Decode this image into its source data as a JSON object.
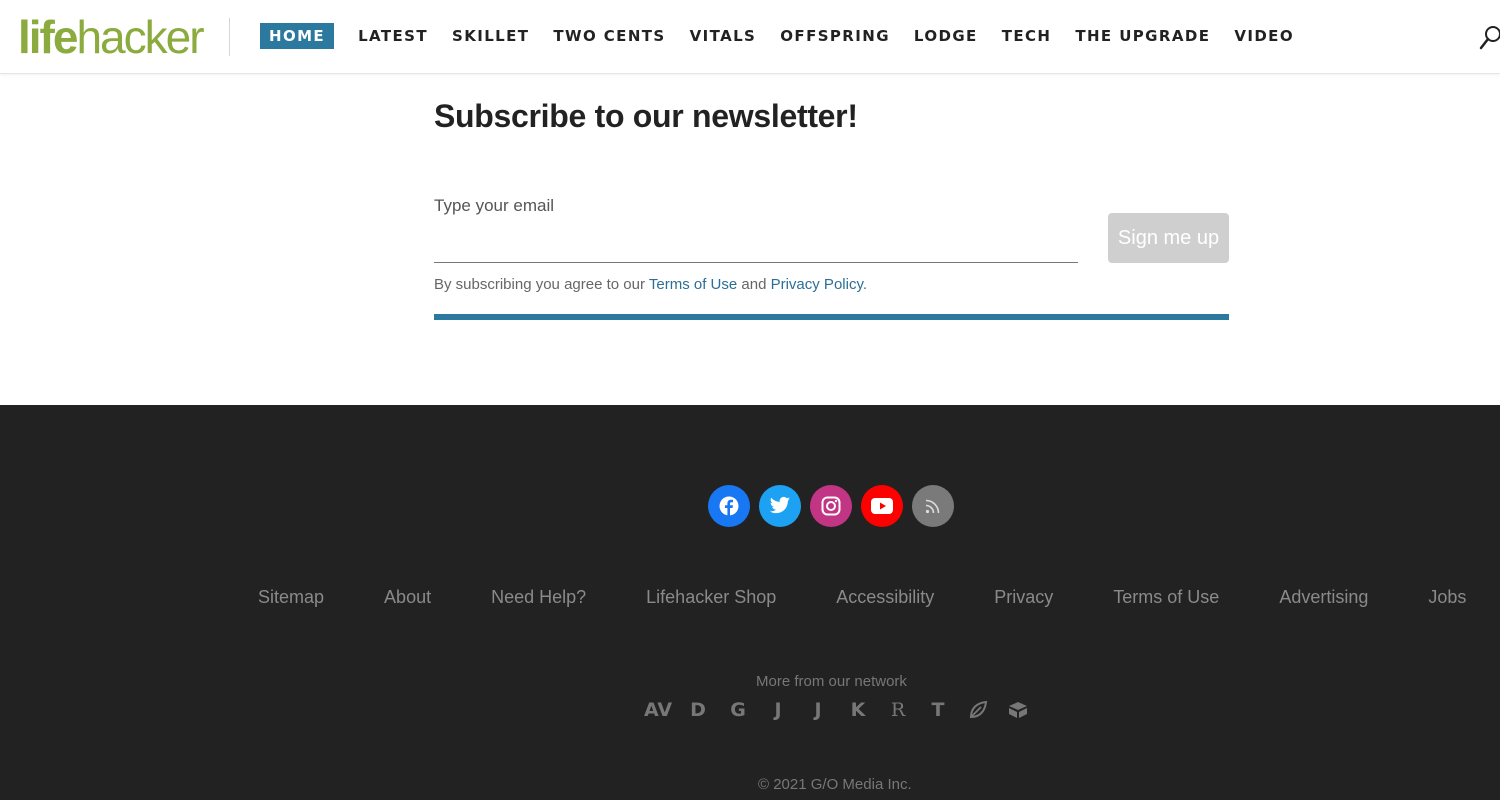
{
  "brand": {
    "logo_part1": "life",
    "logo_part2": "hacker",
    "accent": "#8bab3e",
    "nav_active_color": "#2c79a0"
  },
  "nav": {
    "items": [
      {
        "label": "HOME",
        "active": true
      },
      {
        "label": "LATEST"
      },
      {
        "label": "SKILLET"
      },
      {
        "label": "TWO CENTS"
      },
      {
        "label": "VITALS"
      },
      {
        "label": "OFFSPRING"
      },
      {
        "label": "LODGE"
      },
      {
        "label": "TECH"
      },
      {
        "label": "THE UPGRADE"
      },
      {
        "label": "VIDEO"
      }
    ],
    "search_icon": "search-icon"
  },
  "newsletter": {
    "title": "Subscribe to our newsletter!",
    "email_label": "Type your email",
    "email_value": "",
    "button_label": "Sign me up",
    "agree_prefix": "By subscribing you agree to our ",
    "terms_link": "Terms of Use",
    "agree_and": " and ",
    "privacy_link": "Privacy Policy",
    "agree_suffix": "."
  },
  "footer": {
    "social": [
      {
        "name": "facebook-icon",
        "color": "#1877f2"
      },
      {
        "name": "twitter-icon",
        "color": "#1da1f2"
      },
      {
        "name": "instagram-icon",
        "color": "#c13584"
      },
      {
        "name": "youtube-icon",
        "color": "#ff0000"
      },
      {
        "name": "rss-icon",
        "color": "#7a7a7a"
      }
    ],
    "links": [
      "Sitemap",
      "About",
      "Need Help?",
      "Lifehacker Shop",
      "Accessibility",
      "Privacy",
      "Terms of Use",
      "Advertising",
      "Jobs"
    ],
    "network_label": "More from our network",
    "network": [
      "AV",
      "D",
      "G",
      "J",
      "J",
      "K",
      "R",
      "T",
      "leaf",
      "box"
    ],
    "copyright": "© 2021 G/O Media Inc."
  }
}
